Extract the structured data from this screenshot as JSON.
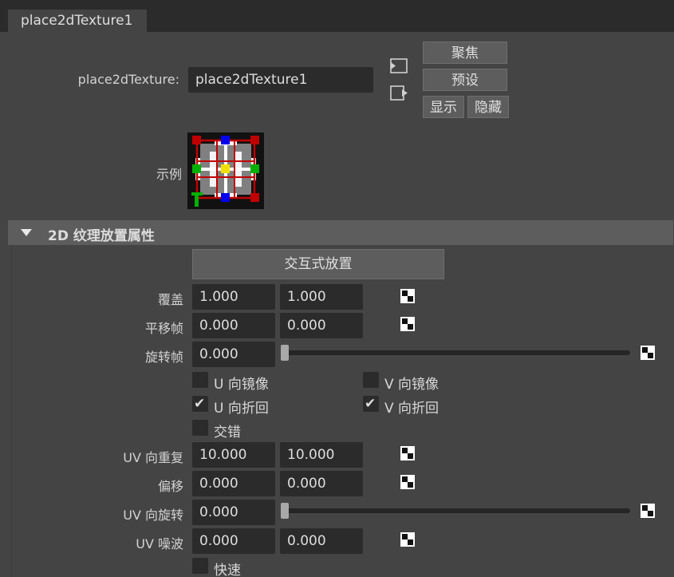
{
  "tab": {
    "label": "place2dTexture1"
  },
  "node": {
    "type_label": "place2dTexture:",
    "name_value": "place2dTexture1",
    "buttons": {
      "focus": "聚焦",
      "presets": "预设",
      "show": "显示",
      "hide": "隐藏"
    }
  },
  "sample": {
    "label": "示例"
  },
  "section": {
    "title": "2D 纹理放置属性"
  },
  "interactive_btn": "交互式放置",
  "rows": {
    "coverage": {
      "label": "覆盖",
      "u": "1.000",
      "v": "1.000"
    },
    "translate_frame": {
      "label": "平移帧",
      "u": "0.000",
      "v": "0.000"
    },
    "rotate_frame": {
      "label": "旋转帧",
      "value": "0.000",
      "slider_fraction": 0.0
    },
    "uv_repeat": {
      "label": "UV 向重复",
      "u": "10.000",
      "v": "10.000"
    },
    "offset": {
      "label": "偏移",
      "u": "0.000",
      "v": "0.000"
    },
    "uv_rotate": {
      "label": "UV 向旋转",
      "value": "0.000",
      "slider_fraction": 0.0
    },
    "uv_noise": {
      "label": "UV 噪波",
      "u": "0.000",
      "v": "0.000"
    }
  },
  "checks": {
    "mirror_u": {
      "label": "U 向镜像",
      "checked": false
    },
    "mirror_v": {
      "label": "V 向镜像",
      "checked": false
    },
    "wrap_u": {
      "label": "U 向折回",
      "checked": true
    },
    "wrap_v": {
      "label": "V 向折回",
      "checked": true
    },
    "stagger": {
      "label": "交错",
      "checked": false
    },
    "fast": {
      "label": "快速",
      "checked": false
    }
  },
  "colors": {
    "panel": "#444444",
    "field": "#2b2b2b",
    "button": "#5d5d5d",
    "section": "#5d5d5d"
  }
}
